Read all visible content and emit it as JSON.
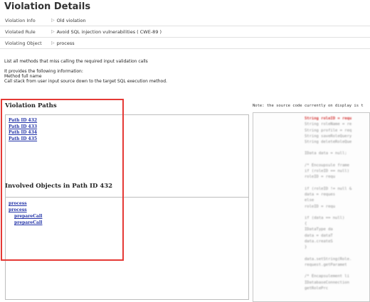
{
  "page": {
    "title": "Violation Details"
  },
  "info": {
    "rows": [
      {
        "label": "Violation Info",
        "value": "Old violation"
      },
      {
        "label": "Violated Rule",
        "value": "Avoid SQL injection vulnerabilities ( CWE-89 )"
      },
      {
        "label": "Violating Object",
        "value": "process"
      }
    ]
  },
  "description": {
    "line1": "List all methods that miss calling the required input validation calls",
    "line2": "It provides the following information:",
    "line3": "Method full name",
    "line4": "Call stack from user input source down to the target SQL execution method."
  },
  "violation_paths": {
    "title": "Violation Paths",
    "items": [
      "Path ID 432",
      "Path ID 433",
      "Path ID 434",
      "Path ID 435"
    ]
  },
  "involved_objects": {
    "title": "Involved Objects in Path ID 432",
    "items": [
      {
        "label": "process",
        "level": 0
      },
      {
        "label": "process",
        "level": 0
      },
      {
        "label": "prepareCall",
        "level": 1
      },
      {
        "label": "prepareCall",
        "level": 1
      }
    ]
  },
  "source": {
    "note": "Note: the source code currently on display is t",
    "highlight_line": "String roleID = requ",
    "lines": [
      "String roleName = re",
      "String profile = req",
      "String saveRoleQuery",
      "String deleteRoleQue",
      "",
      "IData data = null;",
      "",
      "/* Encoupsule frame",
      "if (roleID == null)",
      "    roleID = requ",
      "",
      "if (roleID != null &",
      "    data = reques",
      "else",
      "    roleID = requ",
      "",
      "if (data == null)",
      "{",
      "    IDataType da",
      "    data = dataT",
      "    data.createS",
      "}",
      "",
      "data.setString(Role.",
      "request.getParamet",
      "",
      "/* Encapsulement li",
      "IDatabaseConnection",
      "    getRolePrc"
    ]
  },
  "colors": {
    "highlight": "#e53935",
    "link": "#2233a8",
    "code_highlight": "#d32f2f"
  },
  "icons": {
    "row_marker": "caret-right-icon"
  }
}
